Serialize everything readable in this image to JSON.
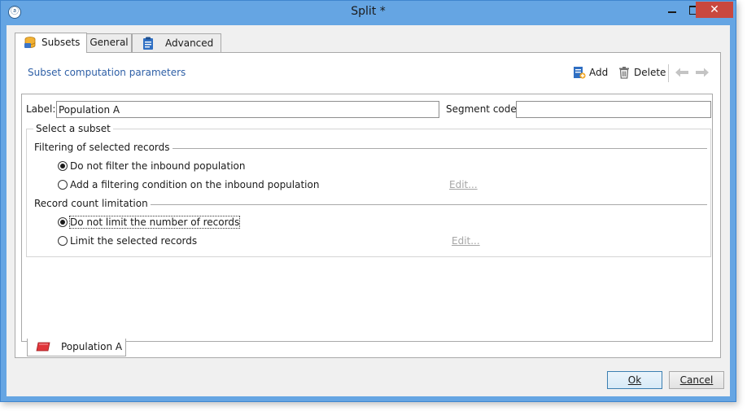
{
  "window": {
    "title": "Split *",
    "close_glyph": "✕"
  },
  "tabs": [
    {
      "label": "Subsets",
      "icon": "database-icon",
      "active": true
    },
    {
      "label": "General",
      "active": false
    },
    {
      "label": "Advanced",
      "icon": "clipboard-icon",
      "active": false
    }
  ],
  "section": {
    "title": "Subset computation parameters"
  },
  "toolbar": {
    "add_label": "Add",
    "delete_label": "Delete"
  },
  "form": {
    "label_caption": "Label:",
    "label_value": "Population A",
    "segment_caption": "Segment code:",
    "segment_value": ""
  },
  "subset_group": {
    "legend": "Select a subset",
    "filtering": {
      "header": "Filtering of selected records",
      "options": [
        {
          "label": "Do not filter the inbound population",
          "selected": true
        },
        {
          "label": "Add a filtering condition on the inbound population",
          "selected": false
        }
      ],
      "edit_label": "Edit..."
    },
    "limitation": {
      "header": "Record count limitation",
      "options": [
        {
          "label": "Do not limit the number of records",
          "selected": true
        },
        {
          "label": "Limit the selected records",
          "selected": false
        }
      ],
      "edit_label": "Edit..."
    }
  },
  "bottom_tab": {
    "label": "Population A",
    "icon": "population-icon"
  },
  "buttons": {
    "ok_label": "Ok",
    "cancel_label": "Cancel"
  },
  "colors": {
    "frame": "#65a5e3",
    "close_button": "#c9483e",
    "section_title": "#2e5fa6",
    "disabled_link": "#a6a6a6"
  }
}
